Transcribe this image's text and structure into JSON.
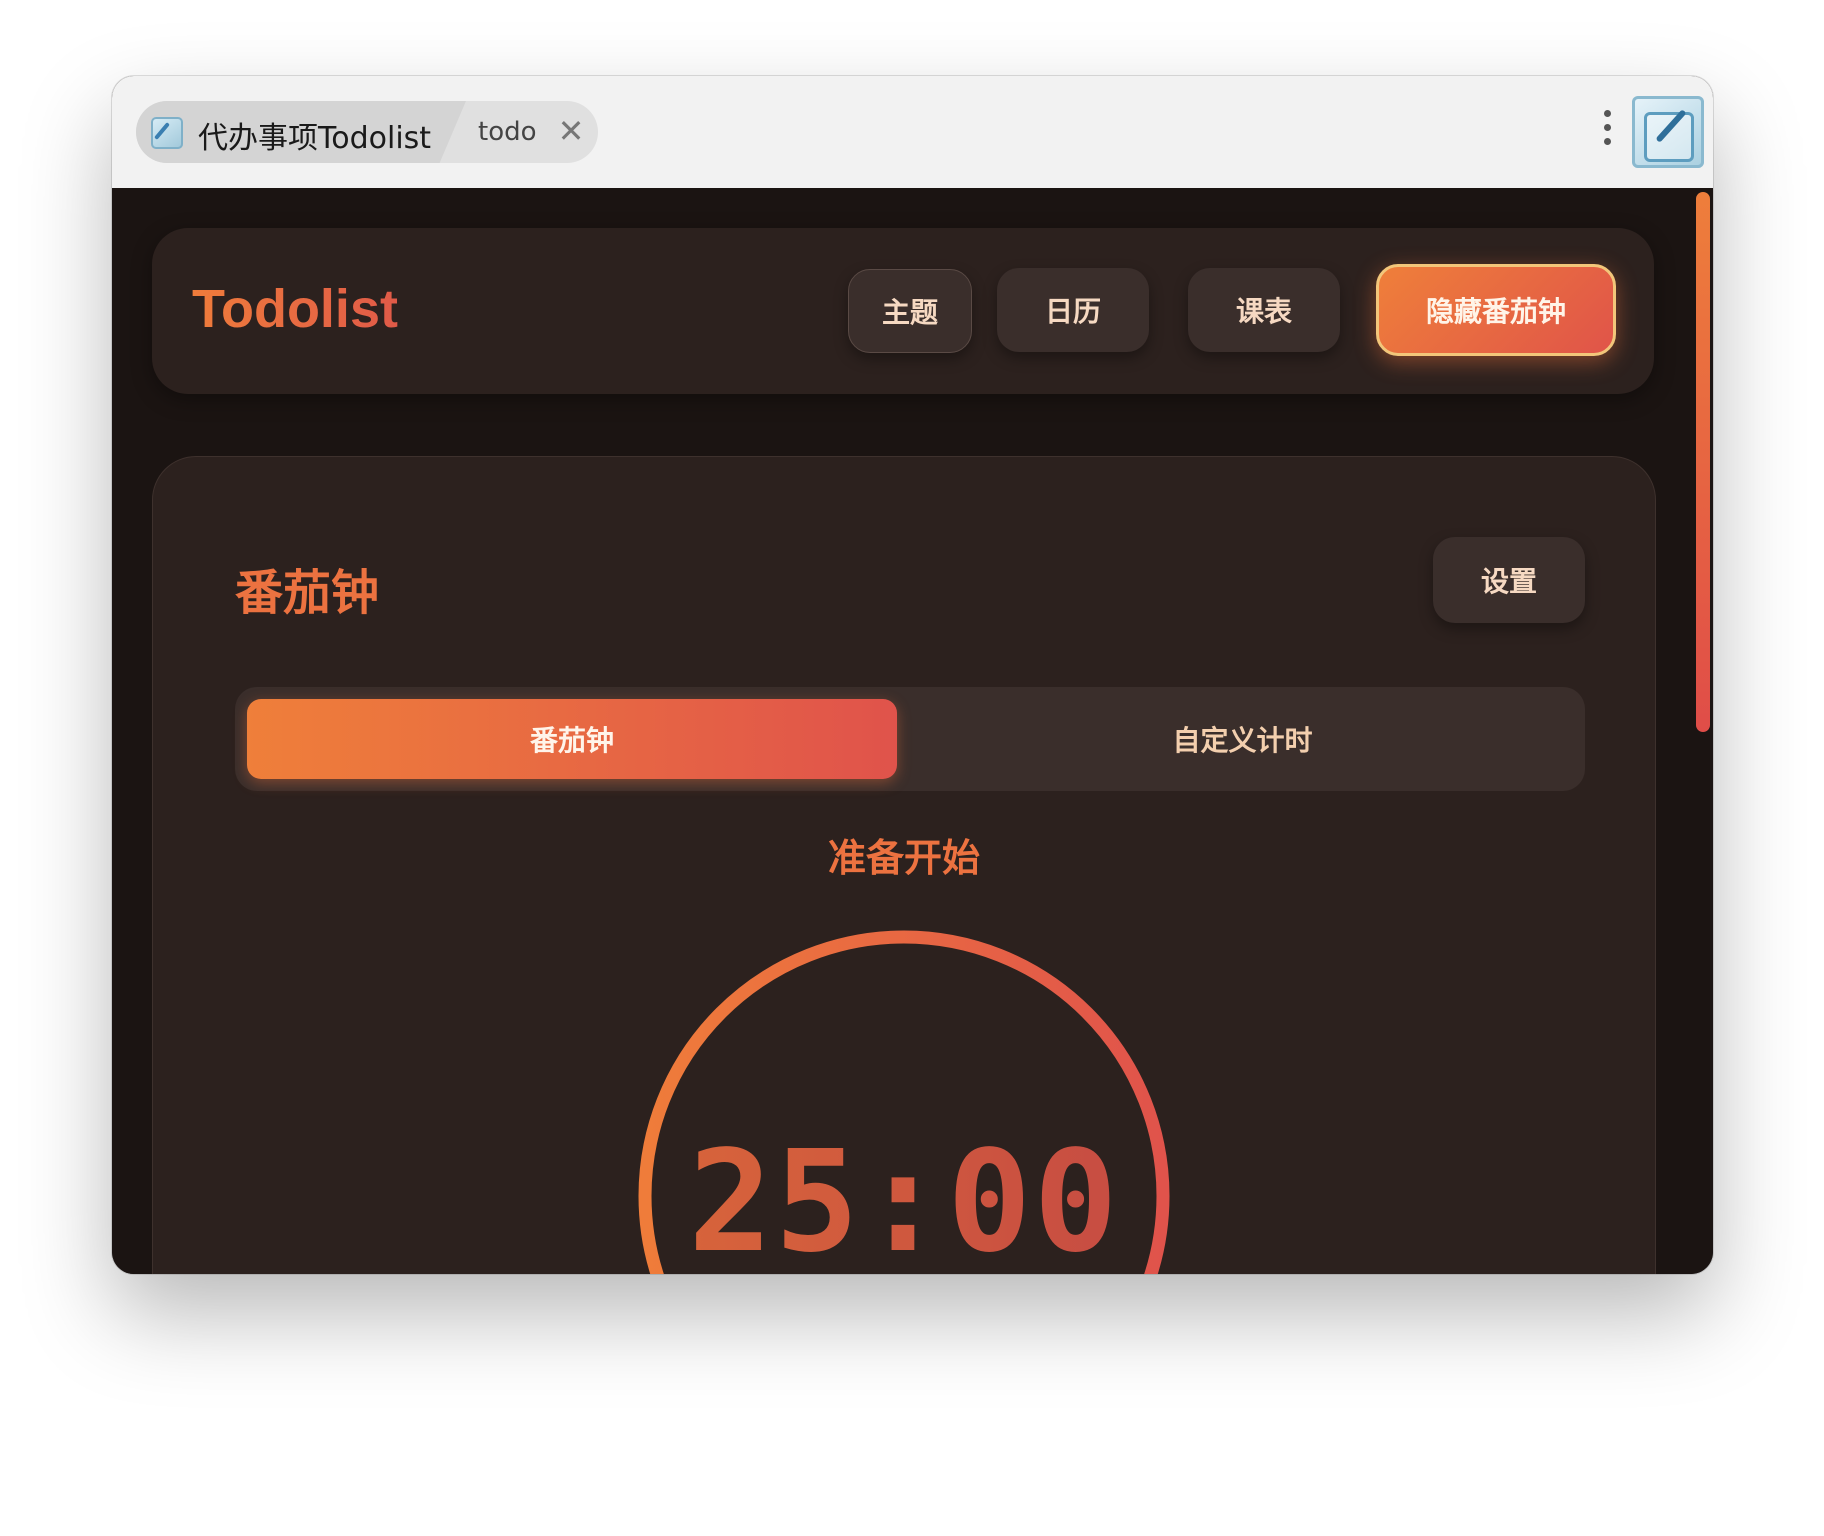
{
  "titlebar": {
    "tab_title": "代办事项Todolist",
    "tab_secondary": "todo",
    "close_glyph": "✕",
    "app_icon": "compose-icon",
    "menu_icon": "kebab-menu-icon"
  },
  "header": {
    "brand": "Todolist",
    "buttons": {
      "theme": "主题",
      "calendar": "日历",
      "schedule": "课表",
      "hide_pomodoro": "隐藏番茄钟"
    }
  },
  "pomodoro": {
    "title": "番茄钟",
    "settings_label": "设置",
    "tabs": {
      "pomodoro": "番茄钟",
      "custom": "自定义计时"
    },
    "active_tab": "pomodoro",
    "status": "准备开始",
    "time": "25:00"
  },
  "colors": {
    "accent_start": "#ef7f3a",
    "accent_end": "#e0534b",
    "background": "#1b1412",
    "card": "#2c211e",
    "button": "#3a2e2b",
    "button_text": "#f6d9c2"
  }
}
